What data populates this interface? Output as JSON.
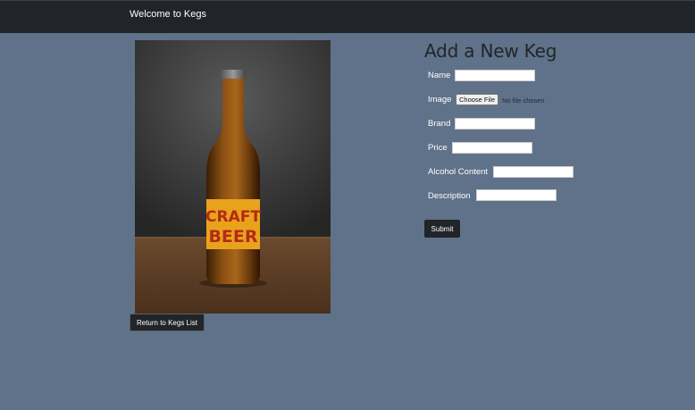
{
  "navbar": {
    "brand": "Welcome to Kegs"
  },
  "hero": {
    "image_alt": "Craft beer bottle",
    "label_line1": "CRAFT",
    "label_line2": "BEER",
    "return_button": "Return to Kegs List"
  },
  "form": {
    "title": "Add a New Keg",
    "fields": {
      "name": {
        "label": "Name",
        "value": ""
      },
      "image": {
        "label": "Image",
        "button": "Choose File",
        "status": "No file chosen"
      },
      "brand": {
        "label": "Brand",
        "value": ""
      },
      "price": {
        "label": "Price",
        "value": ""
      },
      "alcohol": {
        "label": "Alcohol Content",
        "value": ""
      },
      "description": {
        "label": "Description",
        "value": ""
      }
    },
    "submit": "Submit"
  },
  "colors": {
    "page_background": "#5f7289",
    "navbar_background": "#212529",
    "button_background": "#212529",
    "title_color": "#212529"
  }
}
